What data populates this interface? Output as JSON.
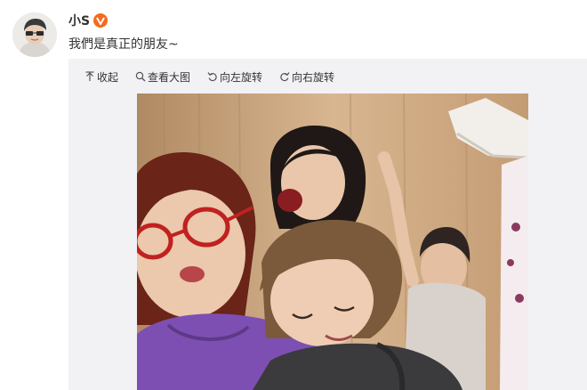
{
  "author": {
    "name": "小S",
    "avatar_icon": "profile-avatar",
    "verified_icon": "verified-v-icon",
    "verified_color": "#f76a1d"
  },
  "post": {
    "text": "我們是真正的朋友~"
  },
  "toolbar": {
    "collapse_label": "收起",
    "collapse_icon": "arrow-up-icon",
    "view_large_label": "查看大图",
    "view_large_icon": "search-icon",
    "rotate_left_label": "向左旋转",
    "rotate_left_icon": "rotate-left-icon",
    "rotate_right_label": "向右旋转",
    "rotate_right_icon": "rotate-right-icon"
  },
  "photo": {
    "description_icon": "group-selfie-photo"
  },
  "colors": {
    "text": "#333333",
    "card_background": "#f2f2f5",
    "accent": "#f76a1d"
  }
}
